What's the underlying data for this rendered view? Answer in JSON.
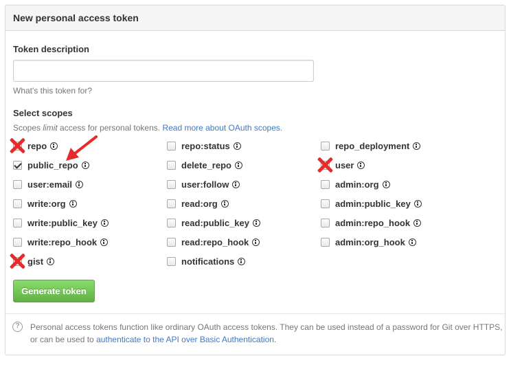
{
  "panel": {
    "title": "New personal access token"
  },
  "description": {
    "label": "Token description",
    "value": "",
    "placeholder": "",
    "help": "What's this token for?"
  },
  "scopes": {
    "heading": "Select scopes",
    "note_before": "Scopes ",
    "note_em": "limit",
    "note_after": " access for personal tokens. ",
    "note_link": "Read more about OAuth scopes",
    "note_end": ".",
    "items": [
      {
        "label": "repo",
        "checked": false,
        "annotation": "red-x"
      },
      {
        "label": "repo:status",
        "checked": false
      },
      {
        "label": "repo_deployment",
        "checked": false
      },
      {
        "label": "public_repo",
        "checked": true,
        "annotation": "red-arrow"
      },
      {
        "label": "delete_repo",
        "checked": false
      },
      {
        "label": "user",
        "checked": false,
        "annotation": "red-x"
      },
      {
        "label": "user:email",
        "checked": false
      },
      {
        "label": "user:follow",
        "checked": false
      },
      {
        "label": "admin:org",
        "checked": false
      },
      {
        "label": "write:org",
        "checked": false
      },
      {
        "label": "read:org",
        "checked": false
      },
      {
        "label": "admin:public_key",
        "checked": false
      },
      {
        "label": "write:public_key",
        "checked": false
      },
      {
        "label": "read:public_key",
        "checked": false
      },
      {
        "label": "admin:repo_hook",
        "checked": false
      },
      {
        "label": "write:repo_hook",
        "checked": false
      },
      {
        "label": "read:repo_hook",
        "checked": false
      },
      {
        "label": "admin:org_hook",
        "checked": false
      },
      {
        "label": "gist",
        "checked": false,
        "annotation": "red-x"
      },
      {
        "label": "notifications",
        "checked": false
      }
    ]
  },
  "generate_button": {
    "label": "Generate token"
  },
  "footer": {
    "text": "Personal access tokens function like ordinary OAuth access tokens. They can be used instead of a password for Git over HTTPS, or can be used to ",
    "link": "authenticate to the API over Basic Authentication",
    "end": "."
  },
  "colors": {
    "link": "#4078c0",
    "button": "#60b044",
    "annotation": "#e52b2b"
  },
  "icons": {
    "info": "info-circle-icon",
    "help": "question-circle-icon"
  }
}
